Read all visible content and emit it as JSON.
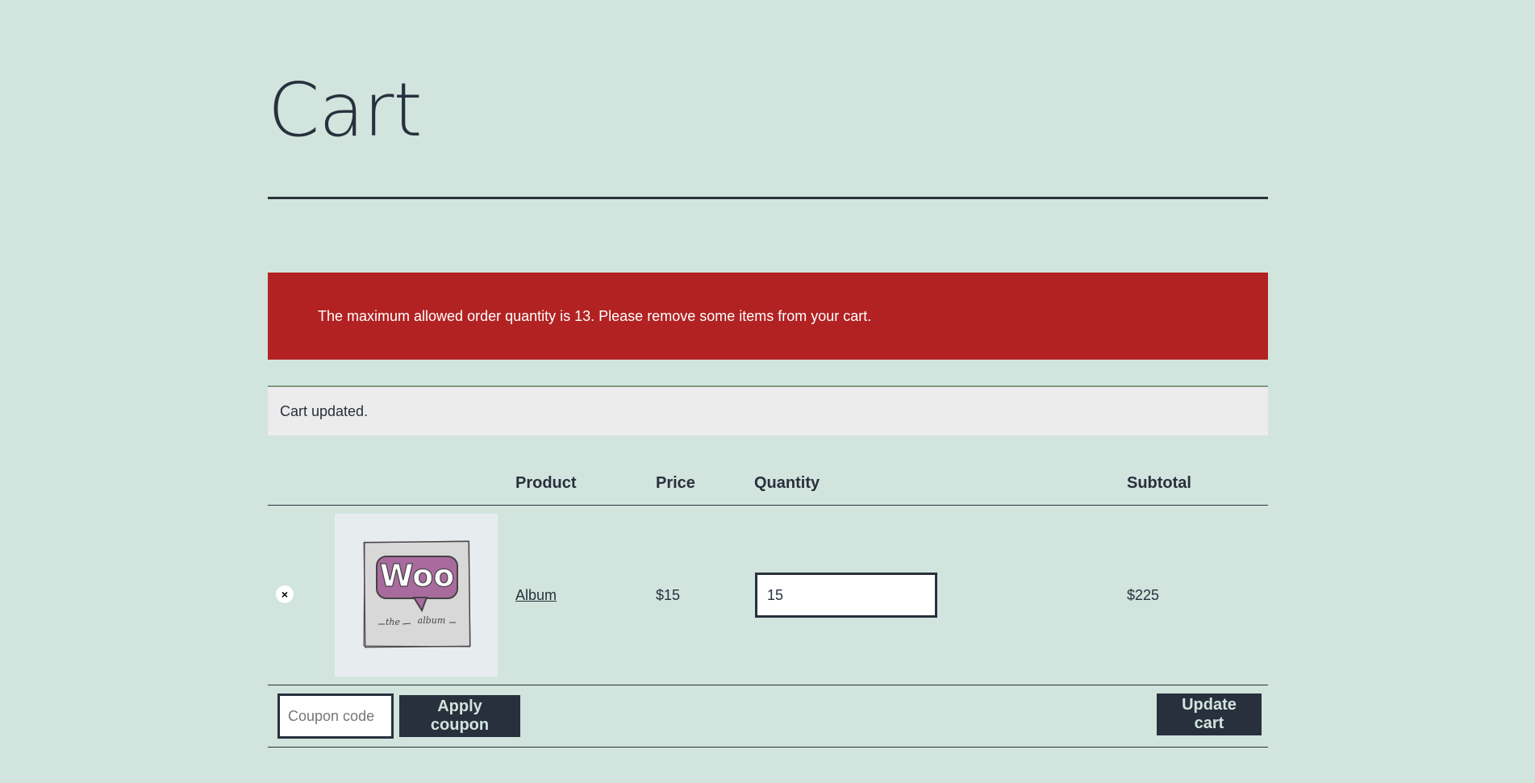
{
  "page": {
    "title": "Cart"
  },
  "notices": {
    "error": "The maximum allowed order quantity is 13. Please remove some items from your cart.",
    "info": "Cart updated."
  },
  "table": {
    "headers": {
      "product": "Product",
      "price": "Price",
      "quantity": "Quantity",
      "subtotal": "Subtotal"
    },
    "rows": [
      {
        "remove_symbol": "×",
        "product_name": "Album",
        "price": "$15",
        "quantity": "15",
        "subtotal": "$225",
        "thumbnail_text_main": "Woo",
        "thumbnail_text_sub1": "the",
        "thumbnail_text_sub2": "album"
      }
    ]
  },
  "actions": {
    "coupon_placeholder": "Coupon code",
    "apply_coupon_label": "Apply coupon",
    "update_cart_label": "Update cart"
  },
  "colors": {
    "background": "#d1e4dd",
    "text": "#28303d",
    "error_bg": "#b22222",
    "info_bg": "#ececec"
  }
}
